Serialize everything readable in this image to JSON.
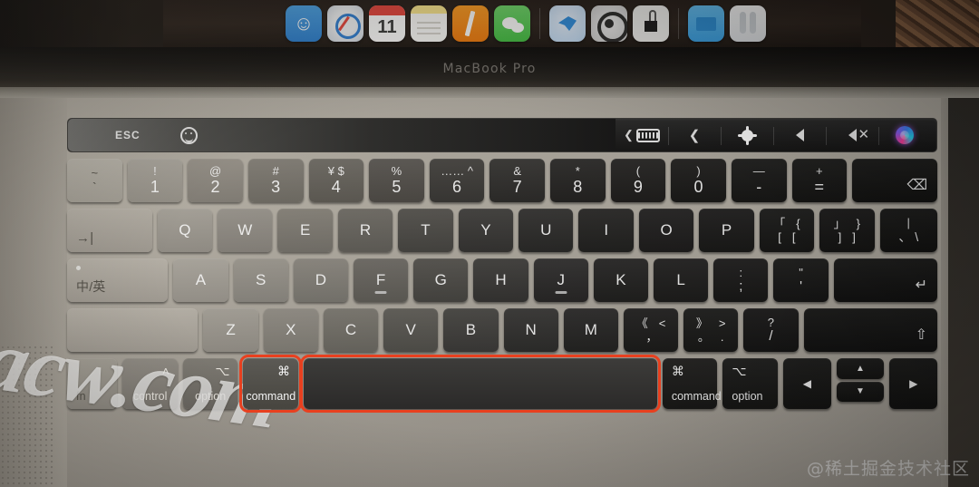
{
  "device": {
    "model_label": "MacBook Pro"
  },
  "dock": {
    "icons": [
      {
        "name": "finder-icon",
        "label": "Finder"
      },
      {
        "name": "safari-icon",
        "label": "Safari"
      },
      {
        "name": "calendar-icon",
        "label": "Calendar",
        "date": "11"
      },
      {
        "name": "notes-icon",
        "label": "Notes"
      },
      {
        "name": "pages-icon",
        "label": "Pages"
      },
      {
        "name": "wechat-icon",
        "label": "WeChat"
      },
      {
        "name": "tim-icon",
        "label": "TIM"
      },
      {
        "name": "cleaner-icon",
        "label": "Disk Utility"
      },
      {
        "name": "circuit-icon",
        "label": "Circuit App"
      },
      {
        "name": "folder-icon",
        "label": "Downloads"
      },
      {
        "name": "airpods-icon",
        "label": "AirPods"
      }
    ]
  },
  "touchbar": {
    "esc_label": "ESC",
    "emoji_icon": "emoji-icon",
    "buttons": [
      {
        "name": "keyboard-expand-icon",
        "label": ""
      },
      {
        "name": "chevron-left-icon",
        "label": "‹"
      },
      {
        "name": "brightness-icon",
        "label": ""
      },
      {
        "name": "volume-icon",
        "label": ""
      },
      {
        "name": "mute-icon",
        "label": ""
      },
      {
        "name": "siri-icon",
        "label": ""
      }
    ]
  },
  "keyboard": {
    "row_numbers": [
      {
        "name": "key-backtick",
        "top": "~",
        "bot": "`",
        "style": "tilde"
      },
      {
        "name": "key-1",
        "top": "!",
        "bot": "1"
      },
      {
        "name": "key-2",
        "top": "@",
        "bot": "2"
      },
      {
        "name": "key-3",
        "top": "#",
        "bot": "3"
      },
      {
        "name": "key-4",
        "top": "¥ $",
        "bot": "4"
      },
      {
        "name": "key-5",
        "top": "%",
        "bot": "5"
      },
      {
        "name": "key-6",
        "top": "…… ^",
        "bot": "6"
      },
      {
        "name": "key-7",
        "top": "&",
        "bot": "7"
      },
      {
        "name": "key-8",
        "top": "*",
        "bot": "8"
      },
      {
        "name": "key-9",
        "top": "(",
        "bot": "9"
      },
      {
        "name": "key-0",
        "top": ")",
        "bot": "0"
      },
      {
        "name": "key-minus",
        "top": "—",
        "bot": "-"
      },
      {
        "name": "key-equal",
        "top": "+",
        "bot": "="
      },
      {
        "name": "key-delete",
        "icon": "⌫"
      }
    ],
    "row_qwerty": {
      "tab": {
        "name": "key-tab",
        "icon": "→|"
      },
      "letters": [
        "Q",
        "W",
        "E",
        "R",
        "T",
        "Y",
        "U",
        "I",
        "O",
        "P"
      ],
      "brackets": [
        {
          "name": "key-bracket-left",
          "t1": "「",
          "t2": "{",
          "b1": "[",
          "b2": "["
        },
        {
          "name": "key-bracket-right",
          "t1": "」",
          "t2": "}",
          "b1": "]",
          "b2": "]"
        }
      ],
      "backslash": {
        "name": "key-backslash",
        "top": "|",
        "bot": "、 \\"
      }
    },
    "row_home": {
      "caps": {
        "name": "key-capslock",
        "label": "中/英"
      },
      "letters": [
        "A",
        "S",
        "D",
        "F",
        "G",
        "H",
        "J",
        "K",
        "L"
      ],
      "semicolon": {
        "name": "key-semicolon",
        "top": ":",
        "bot": ";"
      },
      "quote": {
        "name": "key-quote",
        "top": "\"",
        "bot": "'"
      },
      "return": {
        "name": "key-return",
        "icon": "↵"
      },
      "homing_keys": [
        "F",
        "J"
      ]
    },
    "row_zxcv": {
      "shift_left": {
        "name": "key-shift-left",
        "label": ""
      },
      "letters": [
        "Z",
        "X",
        "C",
        "V",
        "B",
        "N",
        "M"
      ],
      "comma": {
        "name": "key-comma",
        "t1": "《",
        "t2": "<",
        "b1": "，"
      },
      "period": {
        "name": "key-period",
        "t1": "》",
        "t2": ">",
        "b1": "。",
        "b2": "."
      },
      "slash": {
        "name": "key-slash",
        "top": "?",
        "bot": "/"
      },
      "shift_right": {
        "name": "key-shift-right",
        "icon": "⇧"
      }
    },
    "row_bottom": {
      "fn": {
        "name": "key-fn",
        "label": "fn"
      },
      "control": {
        "name": "key-control",
        "symbol": "˄",
        "label": "control"
      },
      "option_left": {
        "name": "key-option-left",
        "symbol": "⌥",
        "label": "option"
      },
      "command_left": {
        "name": "key-command-left",
        "symbol": "⌘",
        "label": "command",
        "highlighted": true
      },
      "space": {
        "name": "key-space",
        "label": "",
        "highlighted": true
      },
      "command_right": {
        "name": "key-command-right",
        "symbol": "⌘",
        "label": "command"
      },
      "option_right": {
        "name": "key-option-right",
        "symbol": "⌥",
        "label": "option"
      },
      "arrow_left": {
        "name": "key-arrow-left",
        "icon": "◀"
      },
      "arrow_up": {
        "name": "key-arrow-up",
        "icon": "▲"
      },
      "arrow_down": {
        "name": "key-arrow-down",
        "icon": "▼"
      },
      "arrow_right": {
        "name": "key-arrow-right",
        "icon": "▶"
      }
    }
  },
  "annotations": {
    "highlight_color": "#e8401f",
    "highlighted_keys": [
      "key-command-left",
      "key-space"
    ]
  },
  "watermarks": {
    "diagonal": "acw.com",
    "corner": "@稀土掘金技术社区"
  }
}
